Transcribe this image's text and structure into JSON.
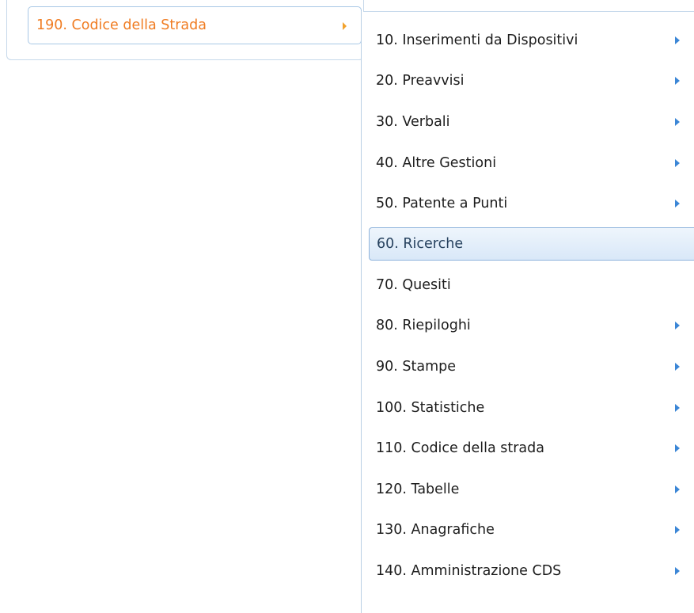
{
  "parent_menu": {
    "item_label": "190. Codice della Strada",
    "item_arrow_icon": "triangle-right-icon",
    "item_color": "#f07c22"
  },
  "submenu": {
    "items": [
      {
        "label": "10. Inserimenti da Dispositivi",
        "has_submenu": true
      },
      {
        "label": "20. Preavvisi",
        "has_submenu": true
      },
      {
        "label": "30. Verbali",
        "has_submenu": true
      },
      {
        "label": "40. Altre Gestioni",
        "has_submenu": true
      },
      {
        "label": "50. Patente a Punti",
        "has_submenu": true
      },
      {
        "label": "60. Ricerche",
        "has_submenu": false,
        "highlighted": true
      },
      {
        "label": "70. Quesiti",
        "has_submenu": false
      },
      {
        "label": "80. Riepiloghi",
        "has_submenu": true
      },
      {
        "label": "90. Stampe",
        "has_submenu": true
      },
      {
        "label": "100. Statistiche",
        "has_submenu": true
      },
      {
        "label": "110. Codice della strada",
        "has_submenu": true
      },
      {
        "label": "120. Tabelle",
        "has_submenu": true
      },
      {
        "label": "130. Anagrafiche",
        "has_submenu": true
      },
      {
        "label": "140. Amministrazione CDS",
        "has_submenu": true
      }
    ],
    "arrow_icon": "triangle-right-icon",
    "highlight_color": "#d9e8f8",
    "arrow_color": "#3b86d6"
  }
}
